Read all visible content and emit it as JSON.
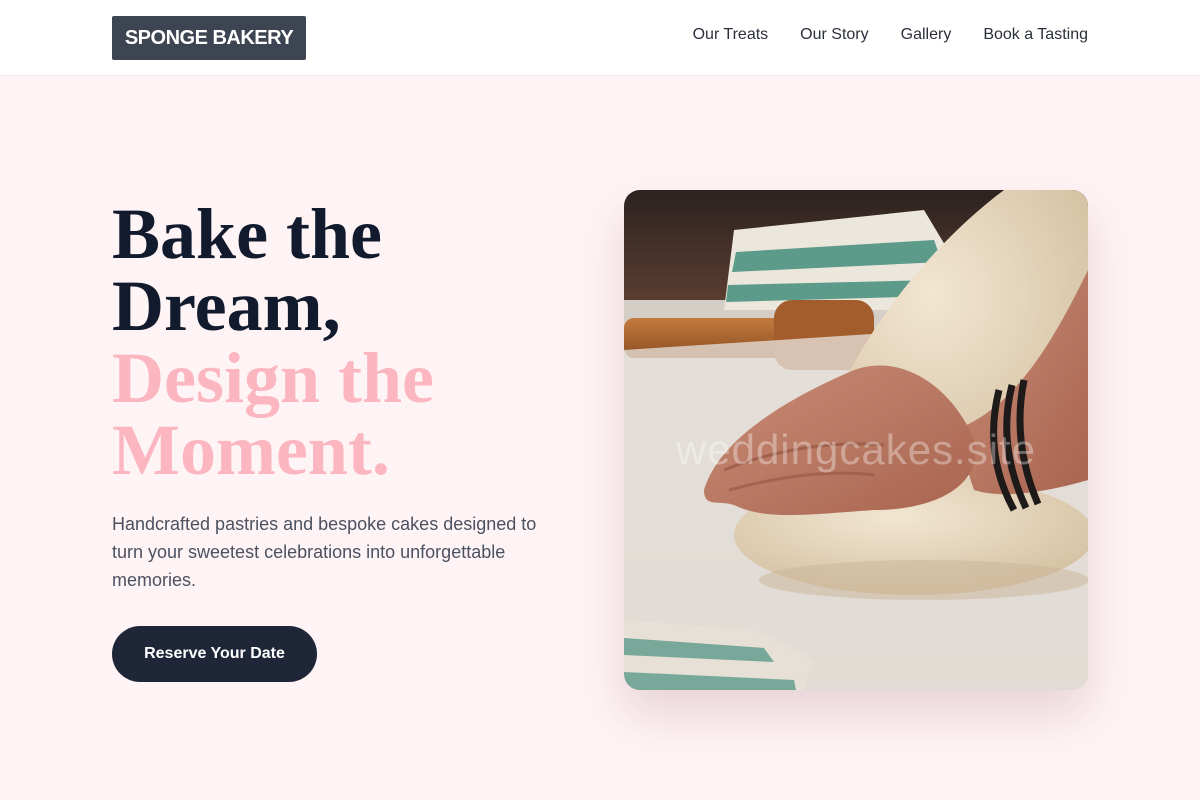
{
  "header": {
    "logo": "SPONGE BAKERY",
    "nav": [
      "Our Treats",
      "Our Story",
      "Gallery",
      "Book a Tasting"
    ]
  },
  "hero": {
    "title_line1": "Bake the",
    "title_line2": "Dream,",
    "accent_line1": "Design the",
    "accent_line2": "Moment.",
    "subtitle": "Handcrafted pastries and bespoke cakes designed to turn your sweetest celebrations into unforgettable memories.",
    "cta_label": "Reserve Your Date"
  },
  "image": {
    "subject": "hands kneading dough on floured surface",
    "watermark": "weddingcakes.site"
  },
  "colors": {
    "background": "#fff4f5",
    "header": "#ffffff",
    "logo_bg": "#3d4452",
    "title_dark": "#121a2e",
    "title_pink": "#fbb6c0",
    "cta_bg": "#1e2638"
  }
}
